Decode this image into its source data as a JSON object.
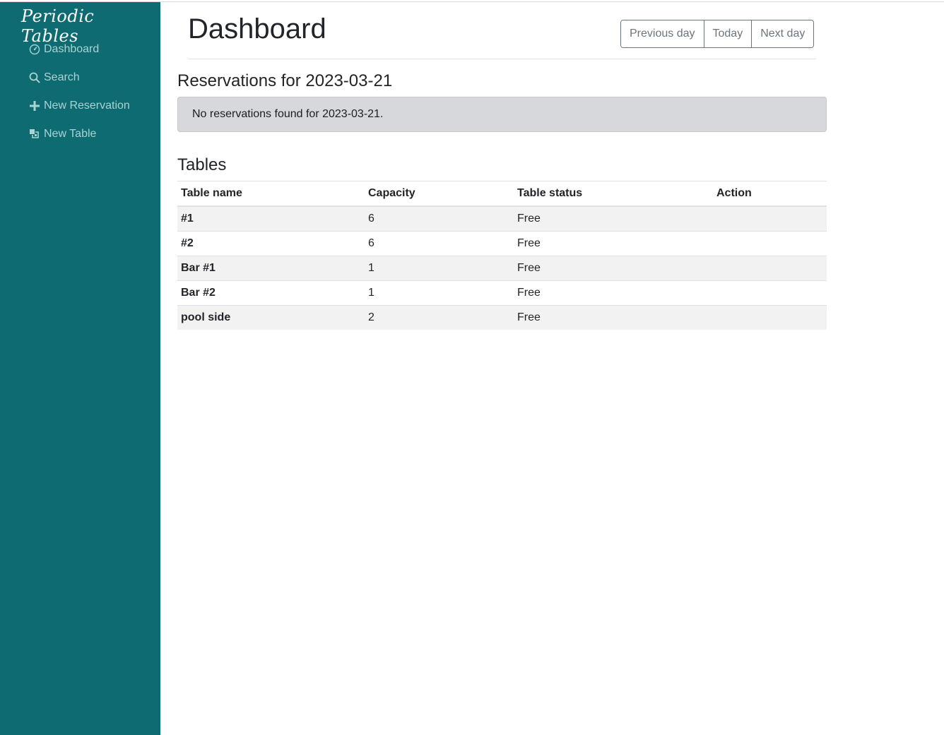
{
  "app": {
    "brand": "Periodic Tables"
  },
  "sidebar": {
    "items": [
      {
        "label": "Dashboard",
        "icon": "dashboard-icon"
      },
      {
        "label": "Search",
        "icon": "search-icon"
      },
      {
        "label": "New Reservation",
        "icon": "plus-icon"
      },
      {
        "label": "New Table",
        "icon": "layers-icon"
      }
    ]
  },
  "header": {
    "title": "Dashboard",
    "buttons": {
      "previous": "Previous day",
      "today": "Today",
      "next": "Next day"
    }
  },
  "reservations": {
    "heading": "Reservations for 2023-03-21",
    "empty_message": "No reservations found for 2023-03-21."
  },
  "tables": {
    "heading": "Tables",
    "columns": [
      "Table name",
      "Capacity",
      "Table status",
      "Action"
    ],
    "rows": [
      {
        "name": "#1",
        "capacity": "6",
        "status": "Free"
      },
      {
        "name": "#2",
        "capacity": "6",
        "status": "Free"
      },
      {
        "name": "Bar #1",
        "capacity": "1",
        "status": "Free"
      },
      {
        "name": "Bar #2",
        "capacity": "1",
        "status": "Free"
      },
      {
        "name": "pool side",
        "capacity": "2",
        "status": "Free"
      }
    ]
  },
  "colors": {
    "sidebar": "#0d6b71",
    "sidebar_text": "#a9d3d4",
    "brand_text": "#ffffff"
  }
}
